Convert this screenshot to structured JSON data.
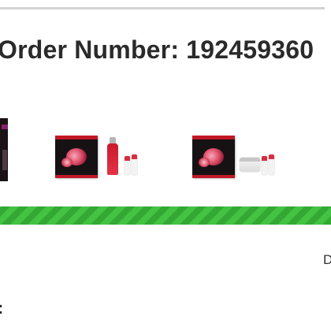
{
  "order": {
    "title": "Order Number: 192459360"
  },
  "products": [
    {
      "icon": "skincare-set-icon",
      "visible": "partial"
    },
    {
      "icon": "skincare-gift-set-icon",
      "colors": [
        "#161214",
        "#c01826",
        "#e43346"
      ]
    },
    {
      "icon": "skincare-gift-set-icon",
      "colors": [
        "#161214",
        "#c01826",
        "#f6f6f6"
      ]
    }
  ],
  "progress": {
    "percent": 100,
    "color": "#33a833"
  },
  "partial_text": {
    "right": "D",
    "left": ":"
  }
}
